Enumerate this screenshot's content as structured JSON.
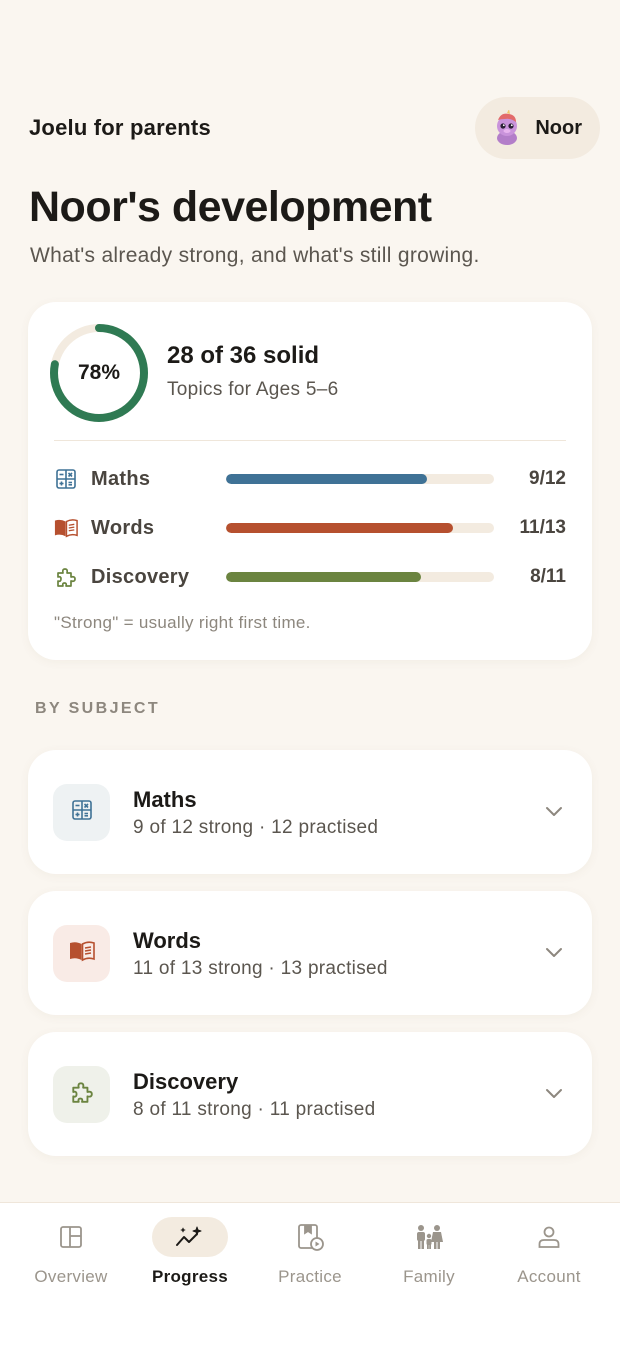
{
  "header": {
    "app_title": "Joelu for parents",
    "profile_name": "Noor"
  },
  "page": {
    "title": "Noor's development",
    "subtitle": "What's already strong, and what's still growing."
  },
  "summary": {
    "percent_label": "78%",
    "percent_value": 0.78,
    "headline": "28 of 36 solid",
    "subline": "Topics for Ages 5–6",
    "subjects": [
      {
        "name": "Maths",
        "count": "9/12",
        "progress": 0.75,
        "color": "#3f7296",
        "icon": "calculator-icon"
      },
      {
        "name": "Words",
        "count": "11/13",
        "progress": 0.846,
        "color": "#b6502f",
        "icon": "book-icon"
      },
      {
        "name": "Discovery",
        "count": "8/11",
        "progress": 0.727,
        "color": "#6b8440",
        "icon": "puzzle-icon"
      }
    ],
    "note": "\"Strong\" = usually right first time."
  },
  "section_label": "BY SUBJECT",
  "subject_cards": [
    {
      "title": "Maths",
      "detail": "9 of 12 strong · 12 practised",
      "tile_color": "#eef2f3",
      "icon": "calculator-icon"
    },
    {
      "title": "Words",
      "detail": "11 of 13 strong · 13 practised",
      "tile_color": "#f9ebe6",
      "icon": "book-icon"
    },
    {
      "title": "Discovery",
      "detail": "8 of 11 strong · 11 practised",
      "tile_color": "#eff1ea",
      "icon": "puzzle-icon"
    }
  ],
  "nav": {
    "items": [
      {
        "label": "Overview",
        "icon": "layout-icon",
        "active": false
      },
      {
        "label": "Progress",
        "icon": "sparkle-chart-icon",
        "active": true
      },
      {
        "label": "Practice",
        "icon": "practice-book-icon",
        "active": false
      },
      {
        "label": "Family",
        "icon": "family-icon",
        "active": false
      },
      {
        "label": "Account",
        "icon": "person-icon",
        "active": false
      }
    ]
  },
  "colors": {
    "background": "#faf6f0",
    "ring_progress": "#2f7a53",
    "ring_track": "#f3ebe0",
    "maths": "#3f7296",
    "words": "#b6502f",
    "discovery": "#6b8440"
  }
}
